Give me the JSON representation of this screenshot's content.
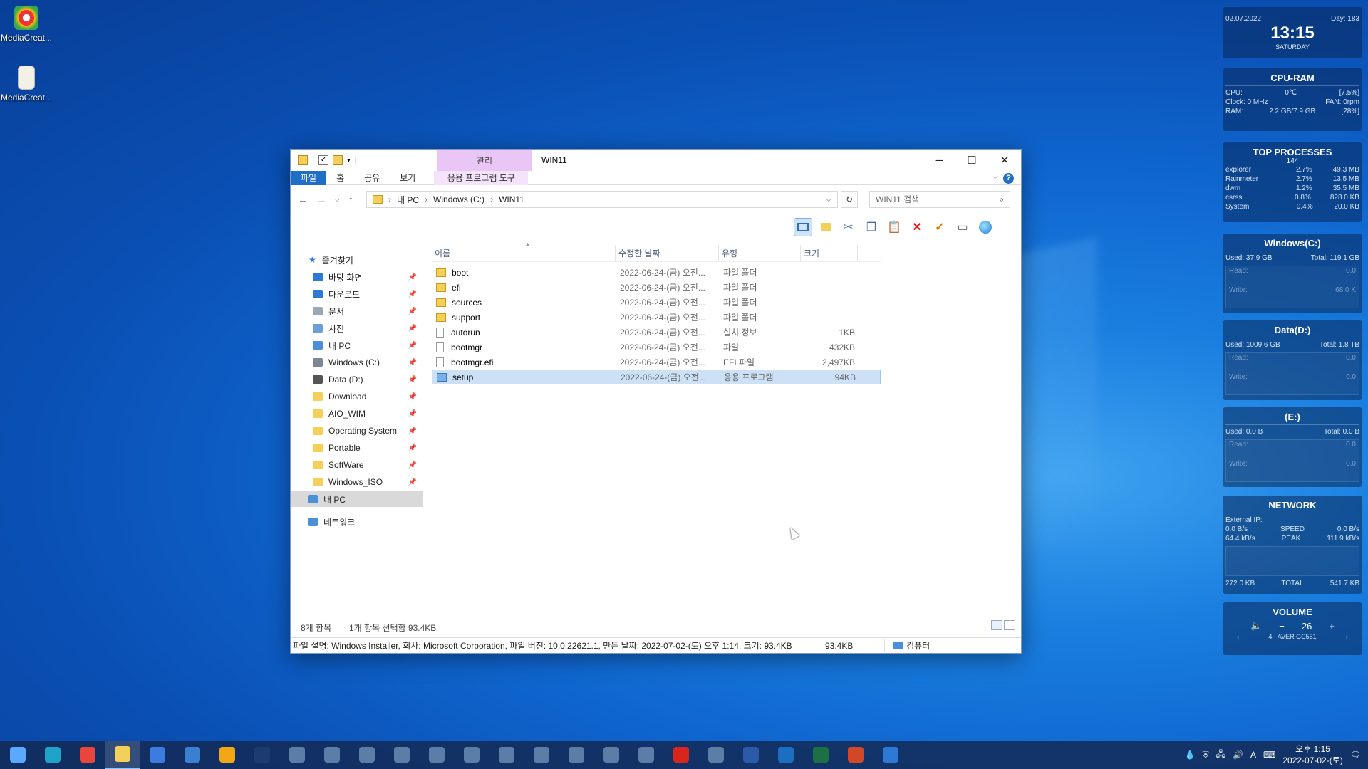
{
  "desktop": {
    "icons": [
      {
        "label": "MediaCreat...",
        "icon": "mediacreation-tool-icon"
      },
      {
        "label": "MediaCreat...",
        "icon": "document-file-icon"
      }
    ]
  },
  "window": {
    "title": "WIN11",
    "context_tab_group": "관리",
    "ribbon_tabs": [
      "파일",
      "홈",
      "공유",
      "보기",
      "응용 프로그램 도구"
    ],
    "breadcrumb": [
      "내 PC",
      "Windows (C:)",
      "WIN11"
    ],
    "search_placeholder": "WIN11 검색",
    "nav": {
      "quick_access": "즐겨찾기",
      "pinned": [
        {
          "label": "바탕 화면",
          "icon": "desktop-icon",
          "color": "#2c7ad6"
        },
        {
          "label": "다운로드",
          "icon": "download-icon",
          "color": "#2c7ad6"
        },
        {
          "label": "문서",
          "icon": "documents-icon",
          "color": "#9aa7b5"
        },
        {
          "label": "사진",
          "icon": "pictures-icon",
          "color": "#6aa0d8"
        },
        {
          "label": "내 PC",
          "icon": "this-pc-icon",
          "color": "#4a90d9"
        },
        {
          "label": "Windows (C:)",
          "icon": "drive-c-icon",
          "color": "#7b8794"
        },
        {
          "label": "Data (D:)",
          "icon": "drive-d-icon",
          "color": "#555555"
        },
        {
          "label": "Download",
          "icon": "folder-icon",
          "color": "#f4cf5a"
        },
        {
          "label": "AIO_WIM",
          "icon": "folder-icon",
          "color": "#f4cf5a"
        },
        {
          "label": "Operating System",
          "icon": "folder-icon",
          "color": "#f4cf5a"
        },
        {
          "label": "Portable",
          "icon": "folder-icon",
          "color": "#f4cf5a"
        },
        {
          "label": "SoftWare",
          "icon": "folder-icon",
          "color": "#f4cf5a"
        },
        {
          "label": "Windows_ISO",
          "icon": "folder-icon",
          "color": "#f4cf5a"
        }
      ],
      "this_pc": "내 PC",
      "network": "네트워크"
    },
    "columns": [
      "이름",
      "수정한 날짜",
      "유형",
      "크기"
    ],
    "files": [
      {
        "name": "boot",
        "date": "2022-06-24-(금) 오전...",
        "type": "파일 폴더",
        "size": "",
        "kind": "folder"
      },
      {
        "name": "efi",
        "date": "2022-06-24-(금) 오전...",
        "type": "파일 폴더",
        "size": "",
        "kind": "folder"
      },
      {
        "name": "sources",
        "date": "2022-06-24-(금) 오전...",
        "type": "파일 폴더",
        "size": "",
        "kind": "folder"
      },
      {
        "name": "support",
        "date": "2022-06-24-(금) 오전...",
        "type": "파일 폴더",
        "size": "",
        "kind": "folder"
      },
      {
        "name": "autorun",
        "date": "2022-06-24-(금) 오전...",
        "type": "설치 정보",
        "size": "1KB",
        "kind": "doc"
      },
      {
        "name": "bootmgr",
        "date": "2022-06-24-(금) 오전...",
        "type": "파일",
        "size": "432KB",
        "kind": "doc"
      },
      {
        "name": "bootmgr.efi",
        "date": "2022-06-24-(금) 오전...",
        "type": "EFI 파일",
        "size": "2,497KB",
        "kind": "doc"
      },
      {
        "name": "setup",
        "date": "2022-06-24-(금) 오전...",
        "type": "응용 프로그램",
        "size": "94KB",
        "kind": "app",
        "selected": true
      }
    ],
    "status": {
      "count": "8개 항목",
      "selection": "1개 항목 선택함 93.4KB",
      "details": "파일 설명: Windows Installer, 회사: Microsoft Corporation, 파일 버전: 10.0.22621.1, 만든 날짜: 2022-07-02-(토) 오후 1:14, 크기: 93.4KB",
      "size": "93.4KB",
      "location": "컴퓨터"
    }
  },
  "widgets": {
    "clock": {
      "date": "02.07.2022",
      "day": "Day: 183",
      "time": "13:15",
      "weekday": "SATURDAY"
    },
    "cpu_ram": {
      "title": "CPU-RAM",
      "cpu_label": "CPU:",
      "cpu_mid": "0℃",
      "cpu_val": "[7.5%]",
      "clock": "Clock: 0 MHz",
      "fan": "FAN: 0rpm",
      "ram_label": "RAM:",
      "ram_mid": "2.2 GB/7.9 GB",
      "ram_val": "[28%]"
    },
    "top": {
      "title": "TOP PROCESSES",
      "count": "144",
      "rows": [
        [
          "explorer",
          "2.7%",
          "49.3 MB"
        ],
        [
          "Rainmeter",
          "2.7%",
          "13.5 MB"
        ],
        [
          "dwm",
          "1.2%",
          "35.5 MB"
        ],
        [
          "csrss",
          "0.8%",
          "828.0 KB"
        ],
        [
          "System",
          "0.4%",
          "20.0 KB"
        ]
      ]
    },
    "drives": [
      {
        "title": "Windows(C:)",
        "used": "Used: 37.9 GB",
        "total": "Total: 119.1 GB",
        "read": "Read:",
        "read_val": "0.0",
        "write": "Write:",
        "write_val": "68.0 K"
      },
      {
        "title": "Data(D:)",
        "used": "Used: 1009.6 GB",
        "total": "Total: 1.8 TB",
        "read": "Read:",
        "read_val": "0.0",
        "write": "Write:",
        "write_val": "0.0"
      },
      {
        "title": "(E:)",
        "used": "Used: 0.0 B",
        "total": "Total: 0.0 B",
        "read": "Read:",
        "read_val": "0.0",
        "write": "Write:",
        "write_val": "0.0"
      }
    ],
    "network": {
      "title": "NETWORK",
      "ip": "External IP:",
      "down": "0.0 B/s",
      "speed": "SPEED",
      "up": "0.0 B/s",
      "down2": "64.4 kB/s",
      "peak": "PEAK",
      "up2": "111.9 kB/s",
      "tot_down": "272.0 KB",
      "total": "TOTAL",
      "tot_up": "541.7 KB"
    },
    "volume": {
      "title": "VOLUME",
      "level": "26",
      "device": "4 - AVER GC551"
    }
  },
  "taskbar": {
    "apps": [
      "start",
      "edge",
      "chrome",
      "explorer",
      "store",
      "mail",
      "aimp",
      "photoshop",
      "app",
      "app",
      "app",
      "app",
      "app",
      "app",
      "app",
      "app",
      "app",
      "app",
      "app",
      "acrobat",
      "app",
      "word",
      "outlook",
      "excel",
      "powerpoint",
      "security"
    ],
    "time": "오후 1:15",
    "date": "2022-07-02-(토)",
    "ime": "A"
  }
}
